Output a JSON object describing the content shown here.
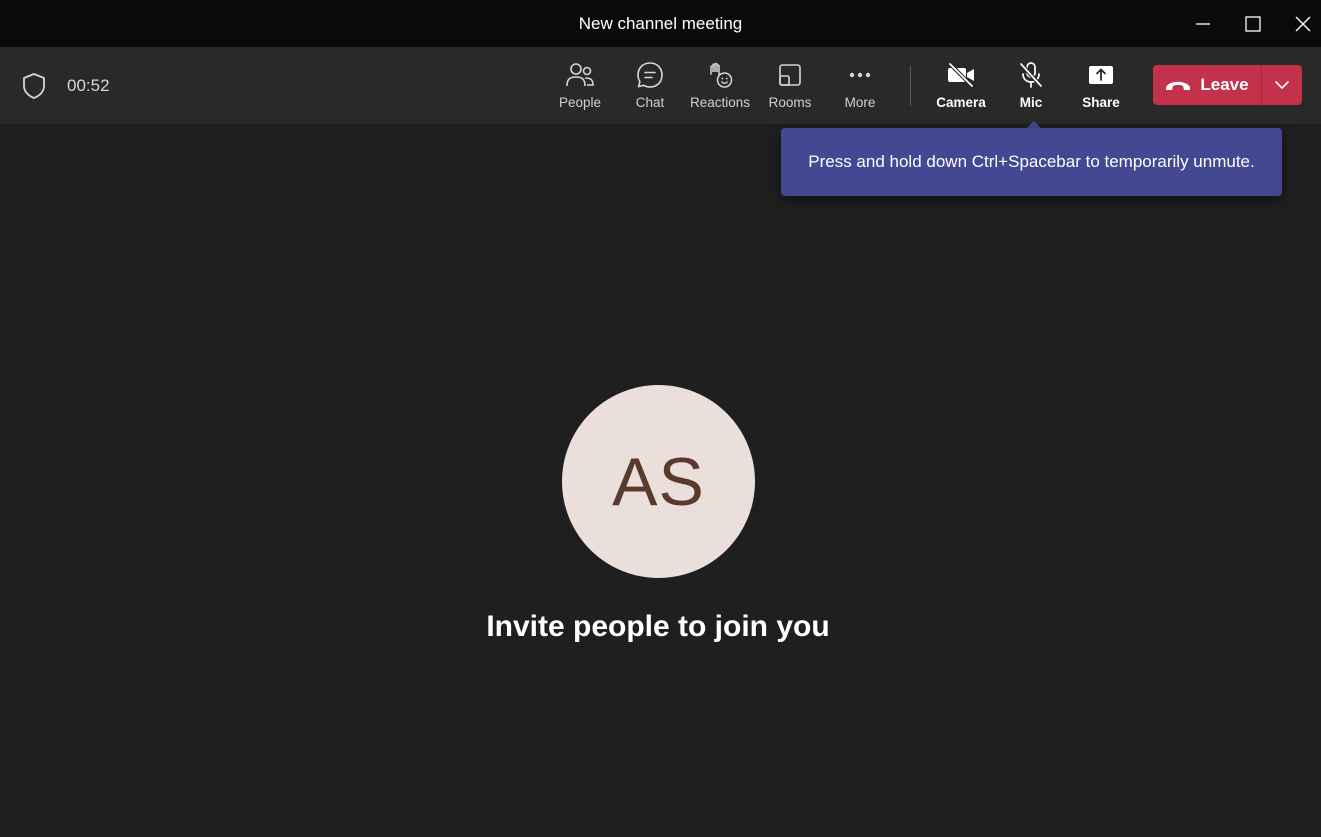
{
  "window": {
    "title": "New channel meeting",
    "controls": [
      "minimize-icon",
      "maximize-icon",
      "close-icon"
    ]
  },
  "toolbar": {
    "timer": "00:52",
    "buttons": [
      {
        "label": "People",
        "icon": "people-icon"
      },
      {
        "label": "Chat",
        "icon": "chat-icon"
      },
      {
        "label": "Reactions",
        "icon": "reactions-icon"
      },
      {
        "label": "Rooms",
        "icon": "rooms-icon"
      },
      {
        "label": "More",
        "icon": "more-icon"
      },
      {
        "label": "Camera",
        "icon": "camera-off-icon"
      },
      {
        "label": "Mic",
        "icon": "mic-off-icon"
      },
      {
        "label": "Share",
        "icon": "share-icon"
      }
    ],
    "leave": {
      "label": "Leave",
      "color": "#c4314b"
    }
  },
  "tooltip": {
    "text": "Press and hold down Ctrl+Spacebar to temporarily unmute.",
    "color": "#444791"
  },
  "stage": {
    "avatar_initials": "AS",
    "invite_text": "Invite people to join you"
  }
}
